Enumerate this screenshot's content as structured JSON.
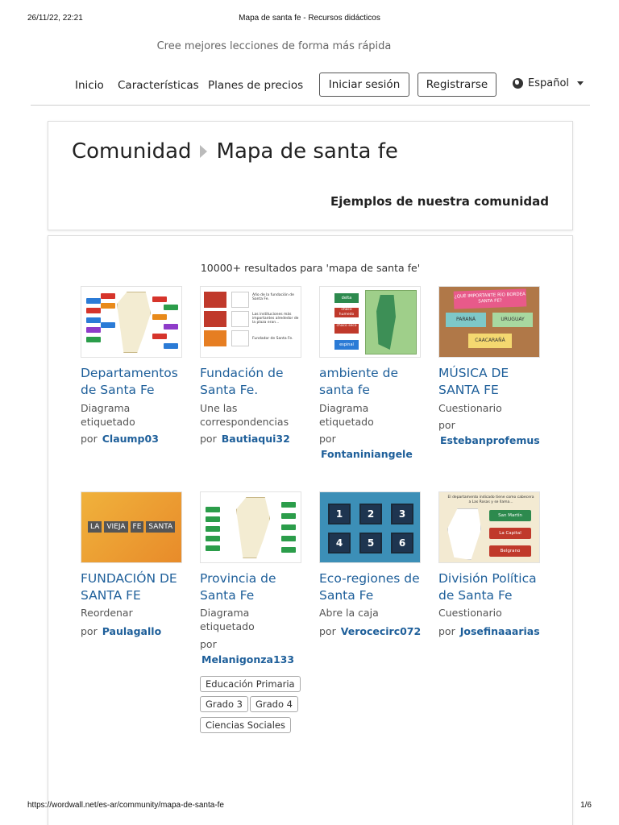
{
  "print": {
    "datetime": "26/11/22, 22:21",
    "title": "Mapa de santa fe - Recursos didácticos",
    "url": "https://wordwall.net/es-ar/community/mapa-de-santa-fe",
    "page": "1/6"
  },
  "header": {
    "tagline": "Cree mejores lecciones de forma más rápida",
    "nav": [
      "Inicio",
      "Características",
      "Planes de precios"
    ],
    "login": "Iniciar sesión",
    "register": "Registrarse",
    "language": "Español"
  },
  "heading": {
    "community": "Comunidad",
    "page": "Mapa de santa fe",
    "subtitle": "Ejemplos de nuestra comunidad"
  },
  "results": {
    "count": "10000+ resultados para 'mapa de santa fe'",
    "by": "por",
    "cards": [
      {
        "title": "Departamentos de Santa Fe",
        "type": "Diagrama etiquetado",
        "author": "Claump03"
      },
      {
        "title": "Fundación de Santa Fe.",
        "type": "Une las correspondencias",
        "author": "Bautiaqui32"
      },
      {
        "title": "ambiente de santa fe",
        "type": "Diagrama etiquetado",
        "author": "Fontaniniangele"
      },
      {
        "title": "MÚSICA DE SANTA FE",
        "type": "Cuestionario",
        "author": "Estebanprofemus"
      },
      {
        "title": "FUNDACIÓN DE SANTA FE",
        "type": "Reordenar",
        "author": "Paulagallo"
      },
      {
        "title": "Provincia de Santa Fe",
        "type": "Diagrama etiquetado",
        "author": "Melanigonza133",
        "tags": [
          "Educación Primaria",
          "Grado 3",
          "Grado 4",
          "Ciencias Sociales"
        ]
      },
      {
        "title": "Eco-regiones de Santa Fe",
        "type": "Abre la caja",
        "author": "Verocecirc072"
      },
      {
        "title": "División Política de Santa Fe",
        "type": "Cuestionario",
        "author": "Josefinaaarias"
      }
    ]
  },
  "thumbs": {
    "fundacion": {
      "q1": "Año de la fundación de Santa Fe.",
      "q2": "Las instituciones más importantes alrededor de la plaza eran...",
      "q3": "Fundador de Santa Fe."
    },
    "ambiente": {
      "labels": [
        "delta",
        "chaco humedo",
        "chaco seco",
        "espinal"
      ]
    },
    "musica": {
      "question": "¿QUÉ IMPORTANTE RÍO BORDEA SANTA FE?",
      "opts": [
        "PARANÁ",
        "URUGUAY",
        "CAACARAÑÁ"
      ]
    },
    "vieja": {
      "words": [
        "LA",
        "VIEJA",
        "FE",
        "SANTA"
      ]
    },
    "eco": {
      "boxes": [
        "1",
        "2",
        "3",
        "4",
        "5",
        "6"
      ]
    },
    "division": {
      "question": "El departamento indicado tiene como cabecera a Las Rosas y se llama...",
      "opts": [
        "San Martín",
        "La Capital",
        "Belgrano"
      ]
    }
  },
  "colors": {
    "link": "#1e5f9a",
    "eco": "#3c8fb7",
    "cork": "#b07848"
  }
}
